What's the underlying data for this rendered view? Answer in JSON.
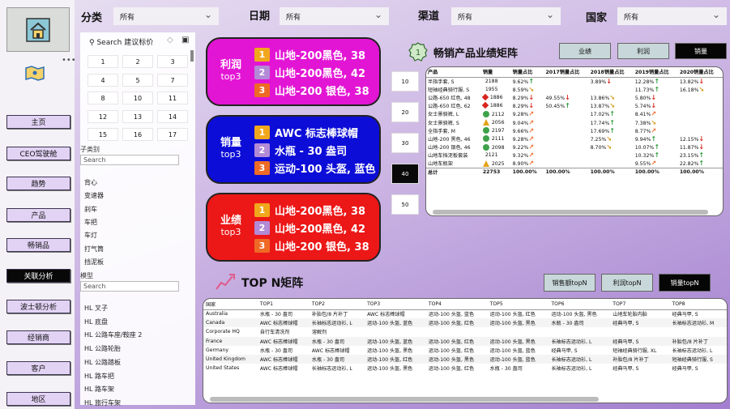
{
  "nav": {
    "items": [
      "主页",
      "CEO驾驶舱",
      "趋势",
      "产品",
      "畅销品",
      "关联分析",
      "波士顿分析",
      "经销商",
      "客户",
      "地区"
    ],
    "active": 5
  },
  "filters": {
    "category": {
      "label": "分类",
      "value": "所有"
    },
    "date": {
      "label": "日期",
      "value": "所有"
    },
    "channel": {
      "label": "渠道",
      "value": "所有"
    },
    "country": {
      "label": "国家",
      "value": "所有"
    }
  },
  "category_panel": {
    "search_placeholder": "Search 建议标价",
    "numbers": [
      "1",
      "2",
      "3",
      "4",
      "5",
      "7",
      "8",
      "10",
      "11",
      "12",
      "13",
      "14",
      "15",
      "16",
      "17"
    ],
    "subcategory_label": "子类别",
    "subcategory_search": "Search",
    "subcategories": [
      "背心",
      "变速器",
      "刹车",
      "车把",
      "车灯",
      "打气筒",
      "挡泥板"
    ],
    "model_label": "模型",
    "model_search": "Search",
    "models": [
      "HL 叉子",
      "HL 底盘",
      "HL 公路车座/鞍座 2",
      "HL 公路轮胎",
      "HL 公路踏板",
      "HL 路车把",
      "HL 路车架",
      "HL 旅行车架"
    ]
  },
  "cards": {
    "profit": {
      "title": "利润",
      "sub": "top3",
      "color": "#e315d4",
      "items": [
        "山地-200黑色, 38",
        "山地-200黑色, 42",
        "山地-200 银色, 38"
      ]
    },
    "volume": {
      "title": "销量",
      "sub": "top3",
      "color": "#0d0dd8",
      "items": [
        "AWC 标志棒球帽",
        "水瓶 - 30 盎司",
        "运动-100 头盔, 蓝色"
      ]
    },
    "sales": {
      "title": "业绩",
      "sub": "top3",
      "color": "#ec1717",
      "items": [
        "山地-200黑色, 38",
        "山地-200黑色, 42",
        "山地-200 银色, 38"
      ]
    }
  },
  "top_buttons": {
    "items": [
      "10",
      "20",
      "30",
      "40",
      "50"
    ],
    "active": 3
  },
  "matrix": {
    "title": "畅销产品业绩矩阵",
    "tabs": [
      "业绩",
      "利润",
      "销量"
    ],
    "active_tab": 2,
    "headers": [
      "产品",
      "销量",
      "销量占比",
      "2017销量占比",
      "2018销量占比",
      "2019销量占比",
      "2020销量占比"
    ],
    "rows": [
      {
        "name": "半指手套, S",
        "ind": "",
        "qty": "2188",
        "pct": "9.62%",
        "pa": "up",
        "y17": "",
        "a17": "",
        "y18": "3.89%",
        "a18": "dn",
        "y19": "12.28%",
        "a19": "up",
        "y20": "13.82%",
        "a20": "dn"
      },
      {
        "name": "短袖经典骑行服, S",
        "ind": "",
        "qty": "1955",
        "pct": "8.59%",
        "pa": "se",
        "y17": "",
        "a17": "",
        "y18": "",
        "a18": "",
        "y19": "11.73%",
        "a19": "up",
        "y20": "16.18%",
        "a20": "se"
      },
      {
        "name": "公路-650 红色, 48",
        "ind": "dia",
        "qty": "1886",
        "pct": "8.29%",
        "pa": "dn",
        "y17": "49.55%",
        "a17": "dn",
        "y18": "13.86%",
        "a18": "se",
        "y19": "5.80%",
        "a19": "dn",
        "y20": "",
        "a20": ""
      },
      {
        "name": "公路-650 红色, 62",
        "ind": "dia",
        "qty": "1886",
        "pct": "8.29%",
        "pa": "dn",
        "y17": "50.45%",
        "a17": "up",
        "y18": "13.87%",
        "a18": "se",
        "y19": "5.74%",
        "a19": "dn",
        "y20": "",
        "a20": ""
      },
      {
        "name": "女士景骑裤, L",
        "ind": "cir",
        "qty": "2112",
        "pct": "9.28%",
        "pa": "ne",
        "y17": "",
        "a17": "",
        "y18": "17.02%",
        "a18": "up",
        "y19": "8.41%",
        "a19": "ne",
        "y20": "",
        "a20": ""
      },
      {
        "name": "女士景骑裤, S",
        "ind": "tri",
        "qty": "2056",
        "pct": "9.04%",
        "pa": "ne",
        "y17": "",
        "a17": "",
        "y18": "17.74%",
        "a18": "up",
        "y19": "7.38%",
        "a19": "se",
        "y20": "",
        "a20": ""
      },
      {
        "name": "全指手套, M",
        "ind": "cir",
        "qty": "2197",
        "pct": "9.66%",
        "pa": "ne",
        "y17": "",
        "a17": "",
        "y18": "17.69%",
        "a18": "up",
        "y19": "8.77%",
        "a19": "ne",
        "y20": "",
        "a20": ""
      },
      {
        "name": "山地-200 黑色, 46",
        "ind": "cir",
        "qty": "2111",
        "pct": "9.28%",
        "pa": "ne",
        "y17": "",
        "a17": "",
        "y18": "7.25%",
        "a18": "se",
        "y19": "9.94%",
        "a19": "up",
        "y20": "12.15%",
        "a20": "dn"
      },
      {
        "name": "山地-200 银色, 46",
        "ind": "cir",
        "qty": "2098",
        "pct": "9.22%",
        "pa": "ne",
        "y17": "",
        "a17": "",
        "y18": "8.70%",
        "a18": "se",
        "y19": "10.07%",
        "a19": "up",
        "y20": "11.87%",
        "a20": "dn"
      },
      {
        "name": "山地车挡泥板套装",
        "ind": "",
        "qty": "2121",
        "pct": "9.32%",
        "pa": "ne",
        "y17": "",
        "a17": "",
        "y18": "",
        "a18": "",
        "y19": "10.32%",
        "a19": "up",
        "y20": "23.15%",
        "a20": "up"
      },
      {
        "name": "山地车瓶架",
        "ind": "tri",
        "qty": "2025",
        "pct": "8.90%",
        "pa": "ne",
        "y17": "",
        "a17": "",
        "y18": "",
        "a18": "",
        "y19": "9.55%",
        "a19": "ne",
        "y20": "22.82%",
        "a20": "up"
      }
    ],
    "total": {
      "name": "总计",
      "qty": "22753",
      "pct": "100.00%",
      "y17": "100.00%",
      "y18": "100.00%",
      "y19": "100.00%",
      "y20": "100.00%"
    }
  },
  "topn": {
    "title": "TOP N矩阵",
    "tabs": [
      "销售额topN",
      "利润topN",
      "销量topN"
    ],
    "active_tab": 2,
    "headers": [
      "国家",
      "TOP1",
      "TOP2",
      "TOP3",
      "TOP4",
      "TOP5",
      "TOP6",
      "TOP7",
      "TOP8"
    ],
    "rows": [
      [
        "Australia",
        "水瓶 - 30 盎司",
        "补胎包/8 片补丁",
        "AWC 标志棒球帽",
        "运动-100 头盔, 蓝色",
        "运动-100 头盔, 红色",
        "运动-100 头盔, 黑色",
        "山地车轮胎内胎",
        "经典马甲, S"
      ],
      [
        "Canada",
        "AWC 标志棒球帽",
        "长袖标志运动衫, L",
        "运动-100 头盔, 蓝色",
        "运动-100 头盔, 红色",
        "运动-100 头盔, 黑色",
        "水瓶 - 30 盎司",
        "经典马甲, S",
        "长袖标志运动衫, M"
      ],
      [
        "Corporate HQ",
        "自行车清洗剂",
        "溶解剂",
        "",
        "",
        "",
        "",
        "",
        ""
      ],
      [
        "France",
        "AWC 标志棒球帽",
        "水瓶 - 30 盎司",
        "运动-100 头盔, 蓝色",
        "运动-100 头盔, 红色",
        "运动-100 头盔, 黑色",
        "长袖标志运动衫, L",
        "经典马甲, S",
        "补胎包/8 片补丁"
      ],
      [
        "Germany",
        "水瓶 - 30 盎司",
        "AWC 标志棒球帽",
        "运动-100 头盔, 黑色",
        "运动-100 头盔, 红色",
        "运动-100 头盔, 蓝色",
        "经典马甲, S",
        "短袖经典骑行服, XL",
        "长袖标志运动衫, L"
      ],
      [
        "United Kingdom",
        "AWC 标志棒球帽",
        "水瓶 - 30 盎司",
        "运动-100 头盔, 红色",
        "运动-100 头盔, 黑色",
        "运动-100 头盔, 蓝色",
        "长袖标志运动衫, L",
        "补胎包/8 片补丁",
        "短袖经典骑行服, S"
      ],
      [
        "United States",
        "AWC 标志棒球帽",
        "长袖标志运动衫, L",
        "运动-100 头盔, 黑色",
        "运动-100 头盔, 红色",
        "水瓶 - 30 盎司",
        "长袖标志运动衫, L",
        "经典马甲, S",
        "经典马甲, S"
      ]
    ]
  },
  "colors": {
    "up": "#2c9b3a",
    "dn": "#d8241c",
    "ne": "#ee6a25",
    "se": "#d49a18"
  }
}
